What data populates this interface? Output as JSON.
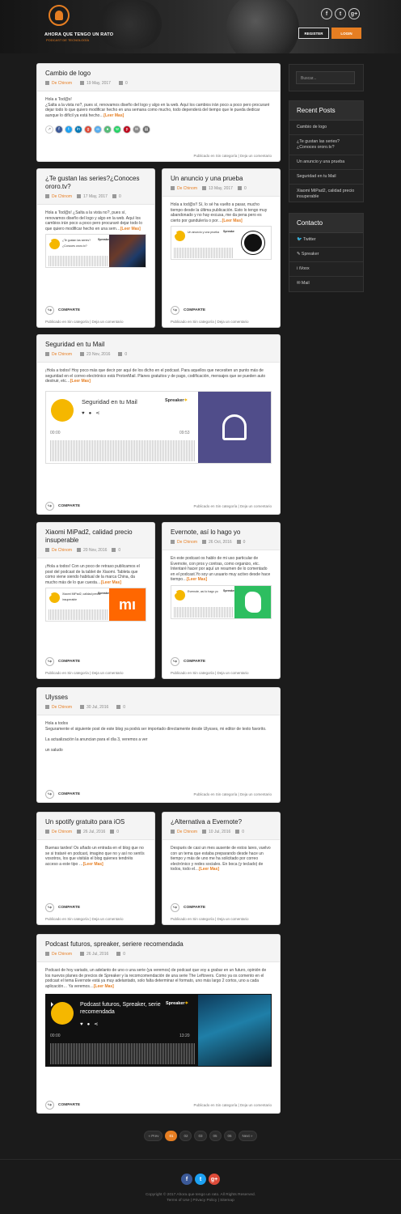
{
  "brand": {
    "name": "AHORA QUE TENGO UN RATO",
    "tagline": "PODCAST DE TECNOLOGÍA"
  },
  "header": {
    "register": "REGISTER",
    "login": "LOGIN",
    "social": [
      "f",
      "t",
      "g+"
    ]
  },
  "posts": [
    {
      "title": "Cambio de logo",
      "author": "De Chinom",
      "date": "19 May, 2017",
      "comments": "0",
      "text": "Hola a Tod@s!\n¿Salta a la vista no?, pues sí, renovamos diseño del logo y algo en la web. Aquí los cambios irán poco a poco pero procuraré dejar todo lo que quiero modificar hecho en una semana como mucho, todo dependerá del tiempo que le pueda dedicar aunque lo difícil ya está hecho…",
      "more": "[Leer Mas]",
      "share": "COMPARTE",
      "footer": "Publicado en Sin categoría | Deja un comentario"
    },
    {
      "title": "¿Te gustan las series?¿Conoces ororo.tv?",
      "author": "De Chinom",
      "date": "17 May, 2017",
      "comments": "0",
      "text": "Hola a Tod@s! ¿Salta a la vista no?, pues sí, renovamos diseño del logo y algo en la web. Aquí los cambios irán poco a poco pero procuraré dejar todo lo que quiero modificar hecho en una sem…",
      "more": "[Leer Mas]",
      "player": "¿Te gustan las series?¿Conoces ororo.tv?",
      "share": "COMPARTE",
      "footer": "Publicado en Sin categoría | Deja un comentario"
    },
    {
      "title": "Un anuncio y una prueba",
      "author": "De Chinom",
      "date": "13 May, 2017",
      "comments": "0",
      "text": "Hola a tod@s!! Sí, lo sé ha vuelto a pasar, mucho tiempo desde la última publicación. Esto lo tengo muy abandonado y no hay excusa, me da pena pero es cierto por gandulería o por…",
      "more": "[Leer Mas]",
      "player": "Un anuncio y una prueba",
      "share": "COMPARTE",
      "footer": "Publicado en Sin categoría | Deja un comentario"
    },
    {
      "title": "Seguridad en tu Mail",
      "author": "De Chinom",
      "date": "23 Nov, 2016",
      "comments": "0",
      "text": "¡Hola a todos! Hoy poco más que decir por aquí de los dicho en el podcast. Para aquellos que necesiten un punto más de seguridad en el correo electrónico está ProtonMail. Planes gratuitos y de pago, codificación, mensajes que se pueden auto destruir, etc…",
      "more": "[Leer Mas]",
      "player": "Seguridad en tu Mail",
      "time_start": "00:00",
      "time_end": "09:53",
      "share": "COMPARTE",
      "footer": "Publicado en Sin categoría | Deja un comentario"
    },
    {
      "title": "Xiaomi MiPad2, calidad precio insuperable",
      "author": "De Chinom",
      "date": "20 Nov, 2016",
      "comments": "0",
      "text": "¡Hola a todos! Con un poco de retraso publicamos el post del podcast de la tablet de Xiaomi. Tableta que como viene siendo habitual de la marca China, da mucho más de lo que cuesta…",
      "more": "[Leer Mas]",
      "player": "Xiaomi MiPad2, calidad precio insuperable",
      "share": "COMPARTE",
      "footer": "Publicado en Sin categoría | Deja un comentario"
    },
    {
      "title": "Evernote, así lo hago yo",
      "author": "De Chinom",
      "date": "26 Oct, 2016",
      "comments": "0",
      "text": "En este podcast os hablo de mi uso particular de Evernote, con pros y contras, como organizo, etc. Intentaré hacer por aquí un resumen de lo comentado en el podcast.Yo soy un usuario muy activo desde hace tiempo…",
      "more": "[Leer Mas]",
      "player": "Evernote, así lo hago yo",
      "share": "COMPARTE",
      "footer": "Publicado en Sin categoría | Deja un comentario"
    },
    {
      "title": "Ulysses",
      "author": "De Chinom",
      "date": "30 Jul, 2016",
      "comments": "0",
      "text": "Hola a todos\nSeguramente el siguiente post de este blog ya podrá ser importado directamente desde Ulysses, mi editor de texto favorito.\n\nLa actualización la anuncian para el día 3, veremos a ver\n\nun saludo",
      "share": "COMPARTE",
      "footer": "Publicado en Sin categoría | Deja un comentario"
    },
    {
      "title": "Un spotify gratuito para iOS",
      "author": "De Chinom",
      "date": "26 Jul, 2016",
      "comments": "0",
      "text": "Buenas tardes! Os añado un entrada en el blog que no se si trataré en podcast, imagino que no y así no sentís vosotros, los que visitáis el blog quienes tendréis acceso a este tipo …",
      "more": "[Leer Mas]",
      "share": "COMPARTE",
      "footer": "Publicado en Sin categoría | Deja un comentario"
    },
    {
      "title": "¿Alternativa a Evernote?",
      "author": "De Chinom",
      "date": "10 Jul, 2016",
      "comments": "0",
      "text": "Después de casi un mes ausente de estos lares, vuelvo con un tema que estaba preparando desde hace un tiempo y más de uno me ha solicitado por correo electrónico y redes sociales. En boca (y teclado) de todos, todo el…",
      "more": "[Leer Mas]",
      "share": "COMPARTE",
      "footer": "Publicado en Sin categoría | Deja un comentario"
    },
    {
      "title": "Podcast futuros, spreaker, seriere recomendada",
      "author": "De Chinom",
      "date": "26 Jul, 2016",
      "comments": "0",
      "text": "Podcast de hoy variado, un adelanto de uno o una serie (ya veremos) de podcast que voy a grabar en un futuro, opinión de los nuevos planes de precios de Spreaker y la recomcomendación de una serie The Leftovers. Como ya os comento en el podcast el tema Evernote está ya muy adelantado, solo falta determinar el formato, uno más largo 2 cortos, uno a cada aplicación… Ya veremos…",
      "more": "[Leer Mas]",
      "player": "Podcast futuros, Spreaker, serie recomendada",
      "time_start": "00:00",
      "time_end": "13:20",
      "share": "COMPARTE",
      "footer": "Publicado en Sin categoría | Deja un comentario"
    }
  ],
  "spreaker": "Spreaker",
  "sidebar": {
    "search_placeholder": "Buscar...",
    "recent_title": "Recent Posts",
    "recent": [
      "Cambio de logo",
      "¿Te gustan las series?¿Conoces ororo.tv?",
      "Un anuncio y una prueba",
      "Seguridad en tu Mail",
      "Xiaomi MiPad2, calidad precio insuperable"
    ],
    "contact_title": "Contacto",
    "contact": [
      "Twitter",
      "Spreaker",
      "iVoox",
      "Mail"
    ]
  },
  "pager": {
    "prev": "« Prev",
    "pages": [
      "01",
      "02",
      "03",
      "05",
      "06"
    ],
    "next": "Next »"
  },
  "footer": {
    "copy": "Copyright © 2017 Ahora que tengo un rato. All Rights Reserved.",
    "links": "Terms of Use | Privacy Policy | Sitemap"
  },
  "colors": {
    "accent": "#e67e22",
    "spreaker": "#f5b700",
    "bg": "#1b1b1b"
  }
}
